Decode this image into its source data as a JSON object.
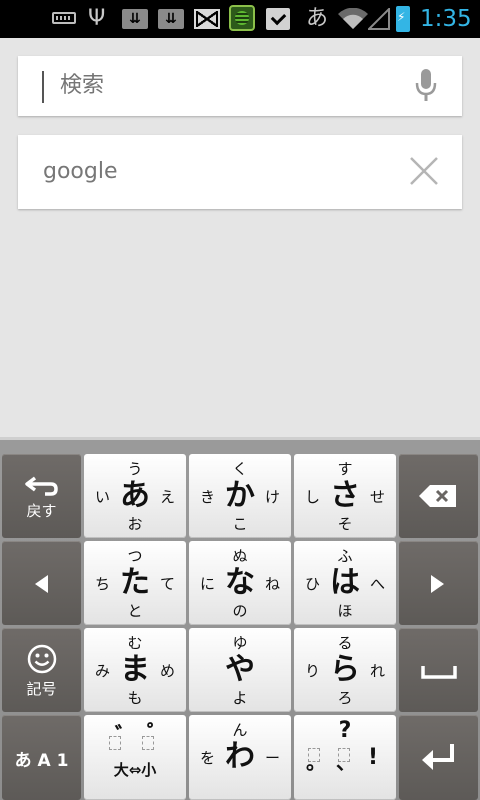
{
  "status_bar": {
    "icons": [
      "keyboard-icon",
      "usb-icon",
      "download-icon",
      "download-icon",
      "gmail-icon",
      "app-icon",
      "market-icon",
      "japanese-ime-icon",
      "wifi-icon",
      "signal-icon",
      "battery-charging-icon"
    ],
    "ime_glyph": "あ",
    "time": "1:35",
    "time_color": "#33b5e5"
  },
  "search": {
    "placeholder": "検索",
    "mic_icon": "microphone-icon"
  },
  "query": {
    "text": "google",
    "clear_icon": "close-icon"
  },
  "keyboard": {
    "left_column": {
      "back_label": "戻す",
      "symbol_label": "記号",
      "mode_label": "あ A 1"
    },
    "keys": {
      "a": {
        "main": "あ",
        "up": "う",
        "left": "い",
        "right": "え",
        "down": "お"
      },
      "ka": {
        "main": "か",
        "up": "く",
        "left": "き",
        "right": "け",
        "down": "こ"
      },
      "sa": {
        "main": "さ",
        "up": "す",
        "left": "し",
        "right": "せ",
        "down": "そ"
      },
      "ta": {
        "main": "た",
        "up": "つ",
        "left": "ち",
        "right": "て",
        "down": "と"
      },
      "na": {
        "main": "な",
        "up": "ぬ",
        "left": "に",
        "right": "ね",
        "down": "の"
      },
      "ha": {
        "main": "は",
        "up": "ふ",
        "left": "ひ",
        "right": "へ",
        "down": "ほ"
      },
      "ma": {
        "main": "ま",
        "up": "む",
        "left": "み",
        "right": "め",
        "down": "も"
      },
      "ya": {
        "main": "や",
        "up": "ゆ",
        "down": "よ"
      },
      "ra": {
        "main": "ら",
        "up": "る",
        "left": "り",
        "right": "れ",
        "down": "ろ"
      },
      "wa": {
        "main": "わ",
        "up": "ん",
        "left": "を",
        "right": "ー"
      },
      "dakuten": {
        "daku": "゛",
        "handaku": "゜",
        "label": "大⇔小"
      },
      "punct": {
        "up": "?",
        "left": "。",
        "mid": "、",
        "right": "!"
      }
    }
  }
}
